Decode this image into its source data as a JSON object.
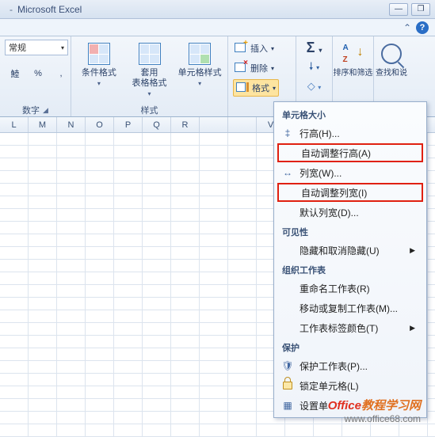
{
  "window": {
    "title": "Microsoft Excel"
  },
  "ribbon": {
    "number": {
      "combo": "常规",
      "group_label": "数字"
    },
    "styles": {
      "cond_fmt": "条件格式",
      "table_fmt": "套用\n表格格式",
      "cell_style": "单元格样式",
      "group_label": "样式"
    },
    "cells": {
      "insert": "插入",
      "delete": "删除",
      "format": "格式"
    },
    "sort": "排序和筛选",
    "find": "查找和说"
  },
  "columns": [
    "L",
    "M",
    "N",
    "O",
    "P",
    "Q",
    "R",
    "",
    "",
    "V"
  ],
  "menu": {
    "sec_cellsize": "单元格大小",
    "row_height": "行高(H)...",
    "auto_row": "自动调整行高(A)",
    "col_width": "列宽(W)...",
    "auto_col": "自动调整列宽(I)",
    "default_col": "默认列宽(D)...",
    "sec_visibility": "可见性",
    "hide_unhide": "隐藏和取消隐藏(U)",
    "sec_org": "组织工作表",
    "rename": "重命名工作表(R)",
    "move_copy": "移动或复制工作表(M)...",
    "tab_color": "工作表标签颜色(T)",
    "sec_protect": "保护",
    "protect_sheet": "保护工作表(P)...",
    "lock_cell": "锁定单元格(L)",
    "cell_settings": "设置单"
  },
  "watermark": {
    "a": "Office",
    "b": "教程学习网",
    "url": "www.office68.com"
  }
}
